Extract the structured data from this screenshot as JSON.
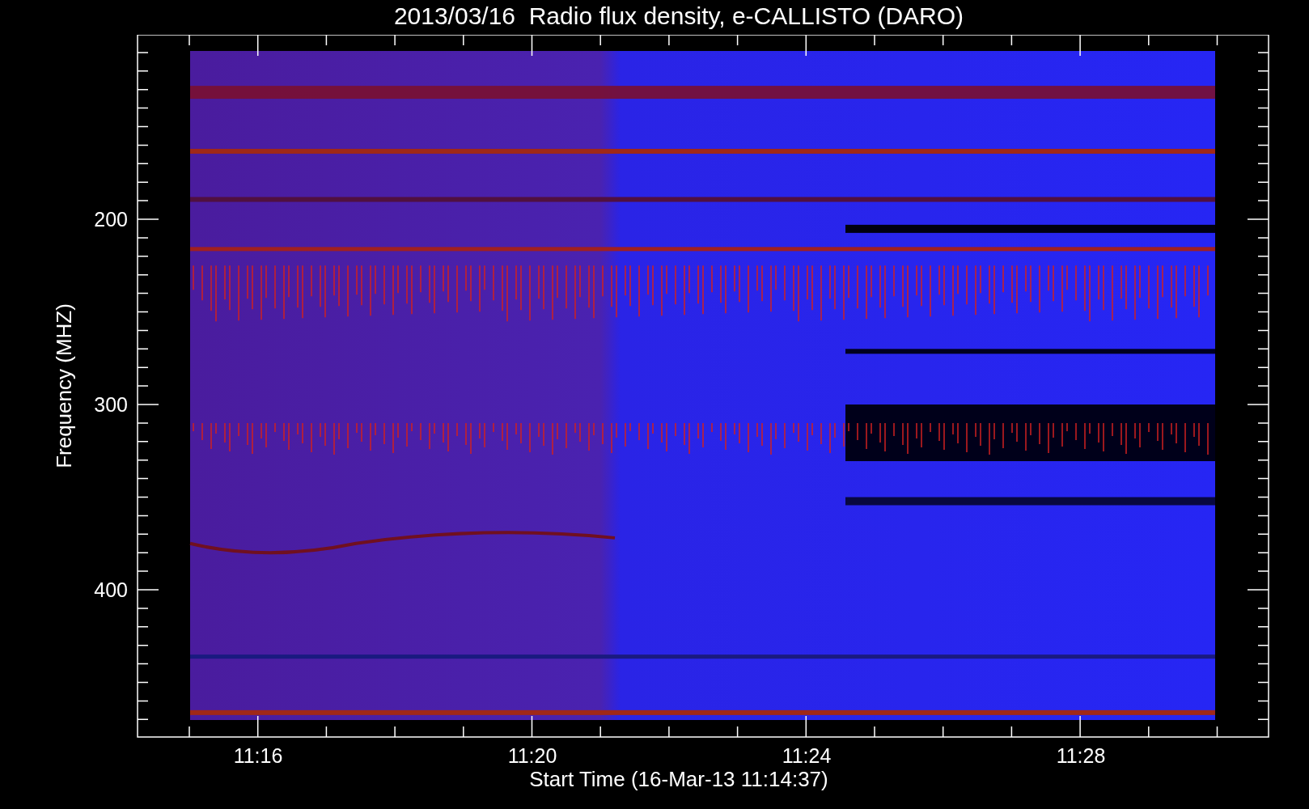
{
  "title": "2013/03/16  Radio flux density, e-CALLISTO (DARO)",
  "plot": {
    "ylabel": "Frequency (MHZ)",
    "yticks": [
      {
        "label": "200"
      },
      {
        "label": "300"
      },
      {
        "label": "400"
      }
    ],
    "xticks": [
      {
        "label": "11:16"
      },
      {
        "label": "11:20"
      },
      {
        "label": "11:24"
      },
      {
        "label": "11:28"
      }
    ],
    "xlabel": "Start Time (16-Mar-13 11:14:37)"
  }
}
